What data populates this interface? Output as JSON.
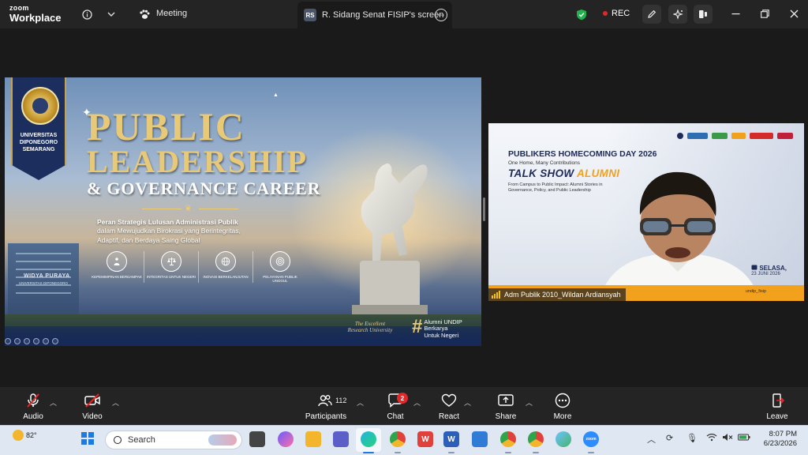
{
  "titlebar": {
    "logo_line1": "zoom",
    "logo_line2": "Workplace",
    "meeting_label": "Meeting",
    "share_tab_badge": "RS",
    "share_tab_label": "R. Sidang Senat FISIP's screen",
    "rec_label": "REC",
    "colors": {
      "bar": "#242424",
      "rec": "#e02828",
      "shield": "#22b14c"
    }
  },
  "slide": {
    "emblem_text": [
      "UNIVERSITAS",
      "DIPONEGORO",
      "SEMARANG"
    ],
    "title_line1": "PUBLIC",
    "title_line2": "LEADERSHIP",
    "title_line3": "& GOVERNANCE CAREER",
    "subtitle_line1": "Peran Strategis Lulusan Administrasi Publik",
    "subtitle_line2": "dalam Mewujudkan Birokrasi yang Berintegritas,",
    "subtitle_line3": "Adaptif, dan Berdaya Saing Global",
    "pillars": [
      {
        "icon": "leadership-icon",
        "label": "Kepemimpinan Berdampak"
      },
      {
        "icon": "scales-icon",
        "label": "Integritas untuk Negeri"
      },
      {
        "icon": "globe-icon",
        "label": "Inovasi Berkelanjutan"
      },
      {
        "icon": "target-icon",
        "label": "Pelayanan Publik Unggul"
      }
    ],
    "building_sign": "WIDYA PURAYA",
    "building_sign_sub": "UNIVERSITAS DIPONEGORO",
    "tagline": "The Excellent Research University",
    "alumni_line1": "Alumni UNDIP",
    "alumni_line2": "Berkarya",
    "alumni_line3": "Untuk Negeri",
    "colors": {
      "gold": "#e8c977",
      "navy": "#1b2e5e"
    }
  },
  "tile": {
    "event_title": "PUBLIKERS HOMECOMING DAY 2026",
    "event_tagline": "One Home, Many Contributions",
    "show_title_main": "TALK SHOW",
    "show_title_accent": "ALUMNI",
    "show_desc_line1": "From Campus to Public Impact: Alumni Stories in",
    "show_desc_line2": "Governance, Policy, and Public Leadership",
    "date_day": "SELASA,",
    "date_full": "23 JUNI 2026",
    "footer_handle": "undip_fisip",
    "participant_name": "Adm Publik 2010_Wildan Ardiansyah",
    "colors": {
      "accent": "#f2a11c",
      "navy": "#1e2a57"
    }
  },
  "toolbar": {
    "audio_label": "Audio",
    "video_label": "Video",
    "participants_label": "Participants",
    "participants_count": "112",
    "chat_label": "Chat",
    "chat_badge": "2",
    "react_label": "React",
    "share_label": "Share",
    "more_label": "More",
    "leave_label": "Leave",
    "colors": {
      "muted": "#e02828",
      "leave": "#e02828"
    }
  },
  "taskbar": {
    "weather_temp": "82°",
    "search_label": "Search",
    "clock_time": "8:07 PM",
    "clock_date": "6/23/2026",
    "apps": [
      "file-explorer-icon",
      "copilot-icon",
      "folder-icon",
      "teams-icon",
      "edge-icon",
      "chrome-icon",
      "wps-icon",
      "word-icon",
      "store-icon",
      "chrome-profile-icon",
      "chrome-profile-icon",
      "maps-icon",
      "zoom-icon"
    ],
    "zoom_app_label": "zoom"
  }
}
